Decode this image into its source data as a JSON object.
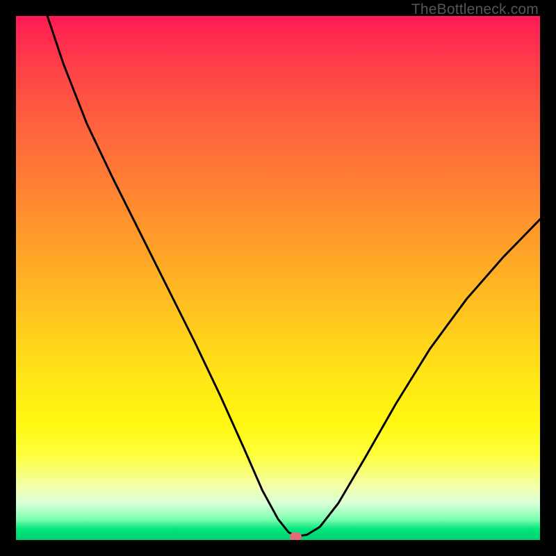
{
  "watermark": "TheBottleneck.com",
  "marker": {
    "x_frac": 0.534,
    "y_frac": 0.994
  },
  "chart_data": {
    "type": "line",
    "title": "",
    "xlabel": "",
    "ylabel": "",
    "xlim": [
      0,
      1
    ],
    "ylim": [
      0,
      1
    ],
    "note": "Axes are not labeled; x and y normalized to [0,1] within the gradient frame. y=0 is bottom (green), y=1 is top (red). Curve depicts a V-shaped bottleneck plot with minimum near x≈0.53.",
    "series": [
      {
        "name": "bottleneck-curve",
        "x": [
          0.06,
          0.09,
          0.135,
          0.185,
          0.235,
          0.29,
          0.34,
          0.39,
          0.435,
          0.47,
          0.5,
          0.52,
          0.535,
          0.555,
          0.58,
          0.615,
          0.665,
          0.725,
          0.79,
          0.86,
          0.93,
          1.0
        ],
        "y": [
          1.0,
          0.91,
          0.795,
          0.69,
          0.59,
          0.48,
          0.38,
          0.275,
          0.175,
          0.095,
          0.04,
          0.015,
          0.007,
          0.01,
          0.025,
          0.07,
          0.155,
          0.26,
          0.365,
          0.46,
          0.54,
          0.612
        ]
      }
    ],
    "gradient_stops": [
      {
        "pos": 0.0,
        "color": "#ff1a55"
      },
      {
        "pos": 0.08,
        "color": "#ff3a4a"
      },
      {
        "pos": 0.18,
        "color": "#ff5a40"
      },
      {
        "pos": 0.3,
        "color": "#ff7a35"
      },
      {
        "pos": 0.45,
        "color": "#ffa328"
      },
      {
        "pos": 0.58,
        "color": "#ffc81e"
      },
      {
        "pos": 0.7,
        "color": "#ffe815"
      },
      {
        "pos": 0.78,
        "color": "#fff810"
      },
      {
        "pos": 0.84,
        "color": "#fdff3e"
      },
      {
        "pos": 0.9,
        "color": "#f2ffae"
      },
      {
        "pos": 0.93,
        "color": "#d8ffd8"
      },
      {
        "pos": 0.96,
        "color": "#7fffb0"
      },
      {
        "pos": 0.98,
        "color": "#00e57a"
      },
      {
        "pos": 1.0,
        "color": "#00cf75"
      }
    ]
  }
}
